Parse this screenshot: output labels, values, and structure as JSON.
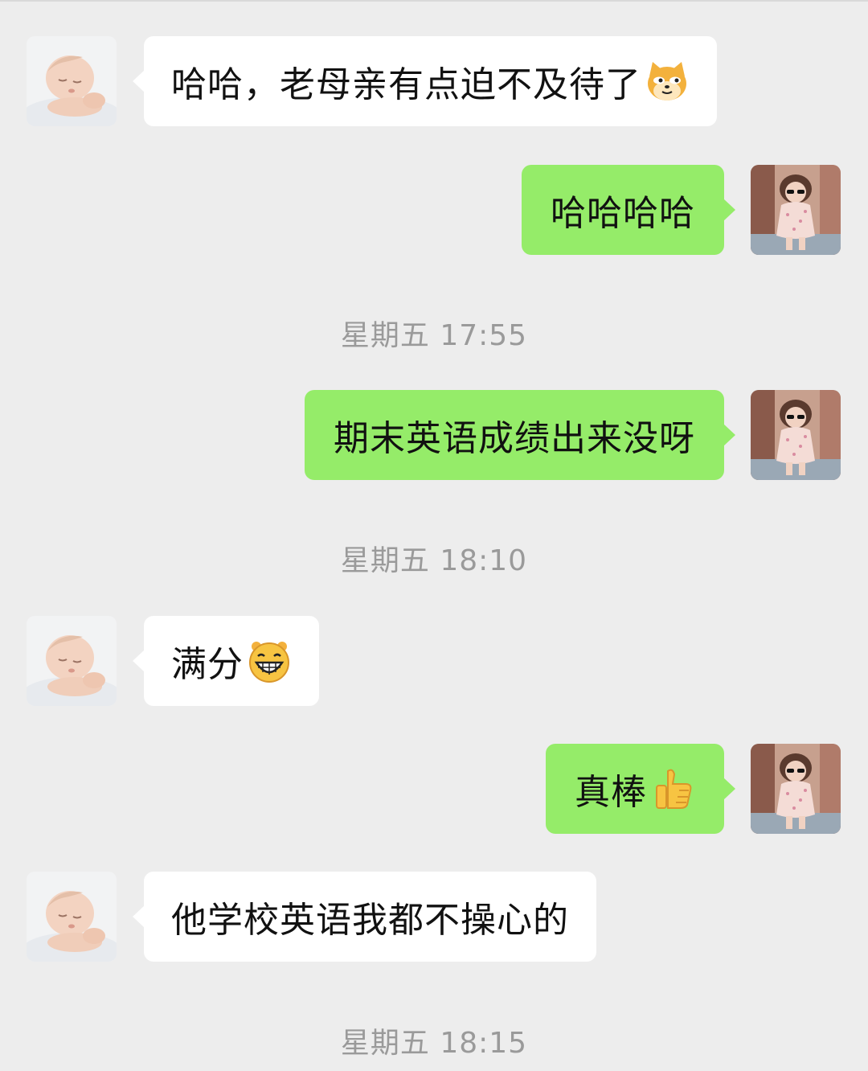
{
  "messages": [
    {
      "side": "left",
      "text": "哈哈，老母亲有点迫不及待了",
      "emoji": "doge-cat-face-icon"
    },
    {
      "side": "right",
      "text": "哈哈哈哈"
    },
    {
      "type": "time",
      "text": "星期五 17:55"
    },
    {
      "side": "right",
      "text": "期末英语成绩出来没呀"
    },
    {
      "type": "time",
      "text": "星期五 18:10"
    },
    {
      "side": "left",
      "text": "满分",
      "emoji": "grin-face-icon"
    },
    {
      "side": "right",
      "text": "真棒",
      "emoji": "thumbs-up-icon"
    },
    {
      "side": "left",
      "text": "他学校英语我都不操心的"
    },
    {
      "type": "time",
      "text": "星期五 18:15"
    }
  ],
  "colors": {
    "background": "#ededed",
    "incoming_bubble": "#ffffff",
    "outgoing_bubble": "#95ec69",
    "timestamp_text": "#9a9a9a"
  }
}
